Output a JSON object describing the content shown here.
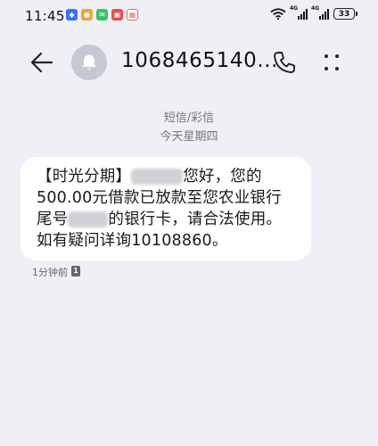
{
  "status_bar": {
    "time": "11:45",
    "sig1_label": "4G",
    "sig2_label": "4G",
    "battery": "33",
    "app_icons": [
      {
        "name": "app-icon-blue",
        "color": "#3b6ff5"
      },
      {
        "name": "app-icon-orange",
        "color": "#f2a33a"
      },
      {
        "name": "app-icon-green",
        "color": "#3cc06a"
      },
      {
        "name": "app-icon-red",
        "color": "#ef4b4b"
      },
      {
        "name": "app-icon-calendar",
        "color": "#f06a4e"
      }
    ]
  },
  "header": {
    "contact": "1068465140...",
    "back_icon": "arrow-left-icon",
    "avatar_icon": "bell-icon",
    "call_icon": "phone-icon",
    "more_icon": "more-vertical-icon"
  },
  "thread": {
    "channel": "短信/彩信",
    "date": "今天星期四"
  },
  "message": {
    "line1_a": "【时光分期】",
    "line1_b": "您好，您的",
    "line2": "500.00元借款已放款至您农业银行",
    "line3_a": "尾号",
    "line3_b": "的银行卡，请合法使用。",
    "line4": "如有疑问详询10108860。",
    "time": "1分钟前",
    "sim": "1"
  },
  "colors": {
    "background": "#eef0f6",
    "bubble": "#ffffff",
    "avatar": "#c5c9d4"
  }
}
